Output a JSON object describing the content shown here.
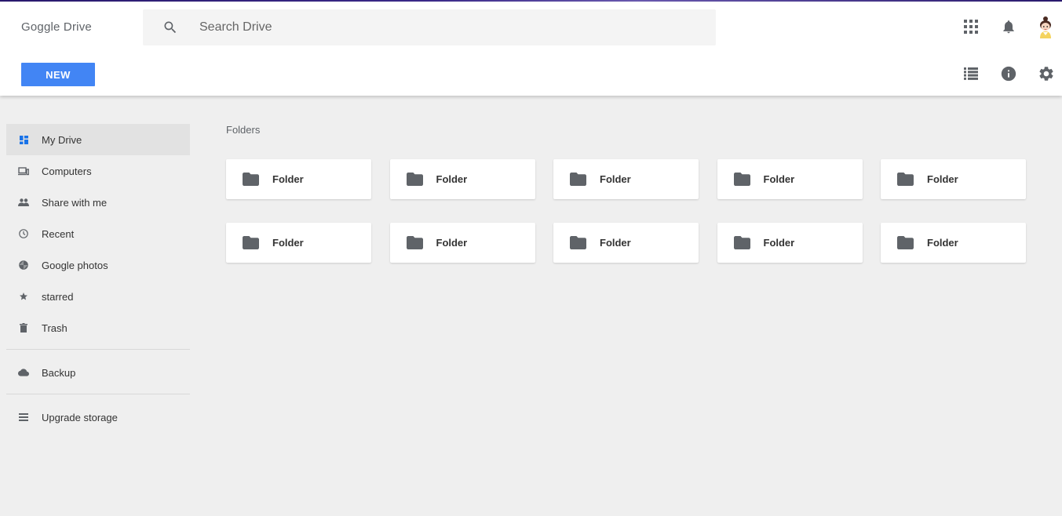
{
  "app": {
    "title": "Goggle Drive"
  },
  "search": {
    "placeholder": "Search Drive",
    "value": ""
  },
  "toolbar": {
    "new_label": "NEW"
  },
  "header_icons": {
    "apps": "apps-grid-icon",
    "notifications": "bell-icon",
    "account": "avatar",
    "list_view": "list-view-icon",
    "info": "info-icon",
    "settings": "gear-icon"
  },
  "sidebar": {
    "items": [
      {
        "label": "My Drive",
        "icon": "my-drive-icon",
        "active": true
      },
      {
        "label": "Computers",
        "icon": "computers-icon"
      },
      {
        "label": "Share with me",
        "icon": "people-icon"
      },
      {
        "label": "Recent",
        "icon": "clock-icon"
      },
      {
        "label": "Google photos",
        "icon": "photos-icon"
      },
      {
        "label": "starred",
        "icon": "star-icon"
      },
      {
        "label": "Trash",
        "icon": "trash-icon"
      }
    ],
    "backup": {
      "label": "Backup",
      "icon": "cloud-icon"
    },
    "upgrade": {
      "label": "Upgrade storage",
      "icon": "storage-icon"
    }
  },
  "main": {
    "section_title": "Folders",
    "folders": [
      {
        "name": "Folder"
      },
      {
        "name": "Folder"
      },
      {
        "name": "Folder"
      },
      {
        "name": "Folder"
      },
      {
        "name": "Folder"
      },
      {
        "name": "Folder"
      },
      {
        "name": "Folder"
      },
      {
        "name": "Folder"
      },
      {
        "name": "Folder"
      },
      {
        "name": "Folder"
      }
    ]
  },
  "colors": {
    "accent": "#4285f4",
    "icon_gray": "#5f6368",
    "background": "#efefef",
    "active_item": "#e2e2e2"
  }
}
